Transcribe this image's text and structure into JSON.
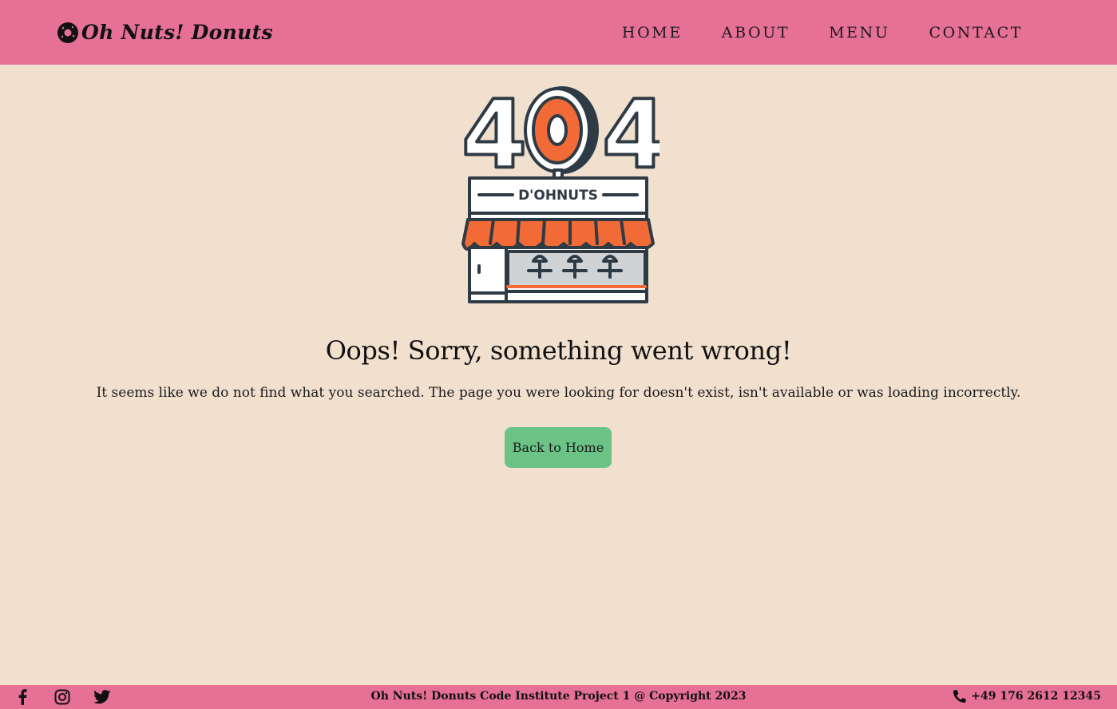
{
  "brand": {
    "name": "Oh Nuts! Donuts",
    "icon": "donut-icon"
  },
  "nav": {
    "items": [
      {
        "label": "HOME"
      },
      {
        "label": "ABOUT"
      },
      {
        "label": "MENU"
      },
      {
        "label": "CONTACT"
      }
    ]
  },
  "illustration": {
    "code_left": "4",
    "code_right": "4",
    "sign": "D'OHNUTS",
    "icon": "donut-shop-404-illustration"
  },
  "main": {
    "headline": "Oops! Sorry, something went wrong!",
    "message": "It seems like we do not find what you searched. The page you were looking for doesn't exist, isn't available or was loading incorrectly.",
    "button_label": "Back to Home"
  },
  "footer": {
    "socials": [
      "facebook-icon",
      "instagram-icon",
      "twitter-icon"
    ],
    "copyright": "Oh Nuts! Donuts Code Institute Project 1 @ Copyright 2023",
    "phone": "+49 176 2612 12345"
  },
  "colors": {
    "header": "#e67096",
    "background": "#f2e0cf",
    "button": "#6bc486",
    "accent_orange": "#f26b36",
    "outline": "#2e3a44"
  }
}
